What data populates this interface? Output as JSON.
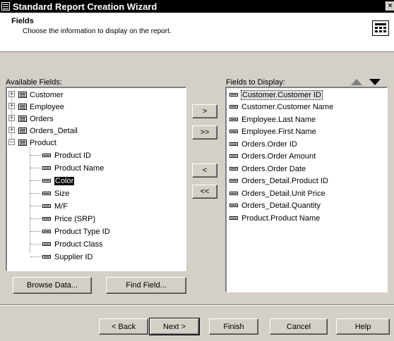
{
  "window": {
    "title": "Standard Report Creation Wizard",
    "close_glyph": "×"
  },
  "header": {
    "title": "Fields",
    "subtitle": "Choose the information to display on the report.",
    "icon": "table-grid-icon"
  },
  "available": {
    "label": "Available Fields:",
    "tables": [
      "Customer",
      "Employee",
      "Orders",
      "Orders_Detail",
      "Product"
    ],
    "product_fields": [
      "Product ID",
      "Product Name",
      "Color",
      "Size",
      "M/F",
      "Price (SRP)",
      "Product Type ID",
      "Product Class",
      "Supplier ID"
    ],
    "selected_field": "Color"
  },
  "transfer": {
    "add": ">",
    "add_all": ">>",
    "remove": "<",
    "remove_all": "<<"
  },
  "display": {
    "label": "Fields to Display:",
    "fields": [
      "Customer.Customer ID",
      "Customer.Customer Name",
      "Employee.Last Name",
      "Employee.First Name",
      "Orders.Order ID",
      "Orders.Order Amount",
      "Orders.Order Date",
      "Orders_Detail.Product ID",
      "Orders_Detail.Unit Price",
      "Orders_Detail.Quantity",
      "Product.Product Name"
    ]
  },
  "lower_buttons": {
    "browse": "Browse Data...",
    "find": "Find Field..."
  },
  "footer": {
    "back": "< Back",
    "next": "Next >",
    "finish": "Finish",
    "cancel": "Cancel",
    "help": "Help"
  }
}
